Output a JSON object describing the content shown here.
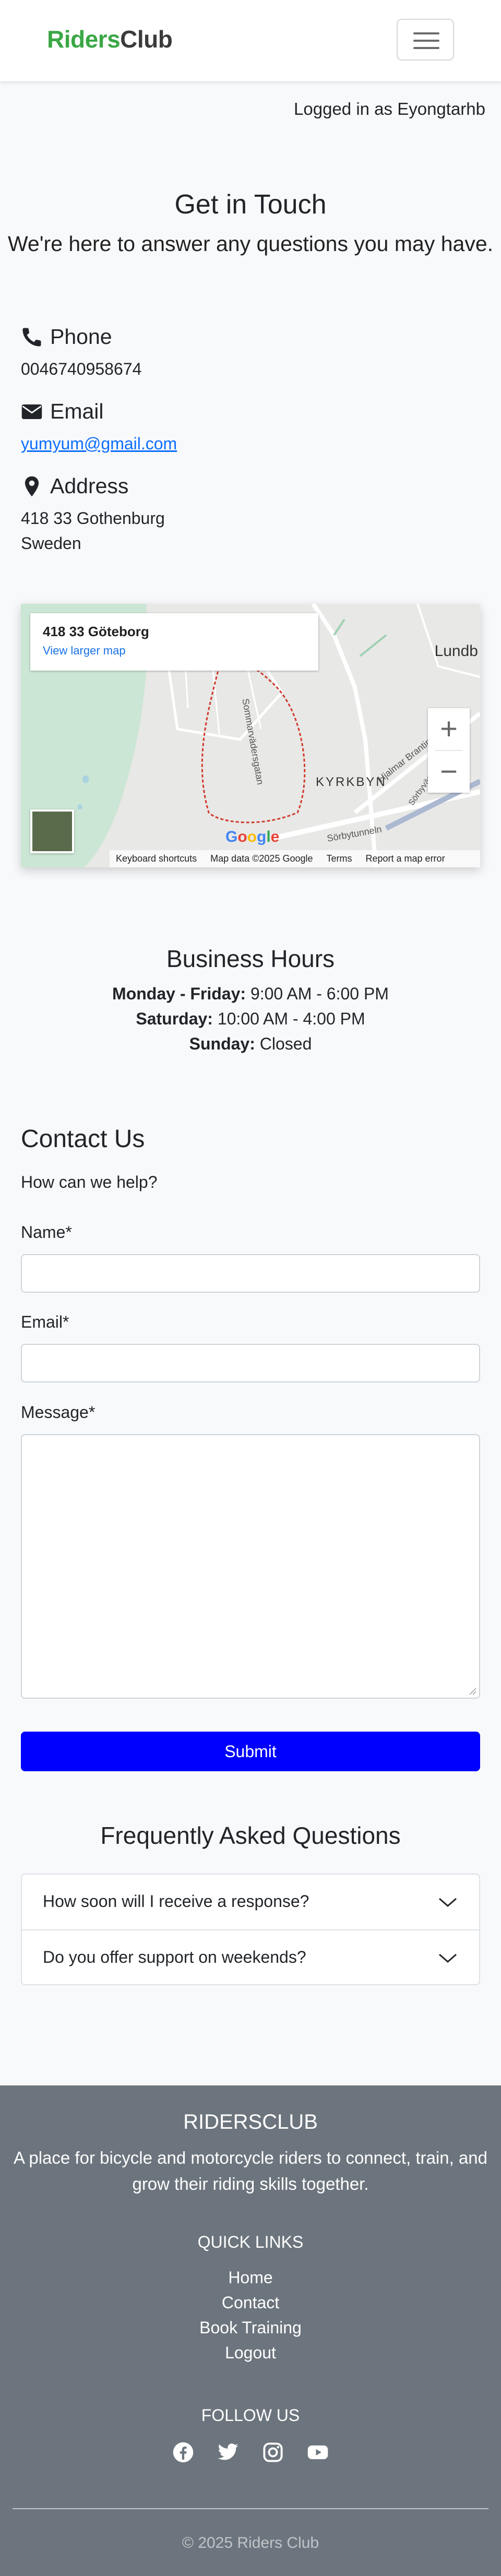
{
  "navbar": {
    "brand_part1": "Riders",
    "brand_part2": "Club"
  },
  "user_status": "Logged in as Eyongtarhb",
  "touch": {
    "title": "Get in Touch",
    "subtitle": "We're here to answer any questions you may have."
  },
  "contact_info": {
    "phone_label": "Phone",
    "phone_value": "0046740958674",
    "email_label": "Email",
    "email_value": "yumyum@gmail.com",
    "address_label": "Address",
    "address_line1": "418 33 Gothenburg",
    "address_line2": "Sweden"
  },
  "map": {
    "place": "418 33 Göteborg",
    "larger_map": "View larger map",
    "city_label": "Lundb",
    "area_label": "KYRKBYN",
    "street1": "Sommarvädersgatan",
    "street2": "Hjalmar Brantingsgatan",
    "street3": "Sörbytunneln",
    "street4": "Sörbyvägen",
    "footer_shortcuts": "Keyboard shortcuts",
    "footer_data": "Map data ©2025 Google",
    "footer_terms": "Terms",
    "footer_report": "Report a map error",
    "google": [
      "G",
      "o",
      "o",
      "g",
      "l",
      "e"
    ]
  },
  "business_hours": {
    "title": "Business Hours",
    "rows": [
      {
        "day": "Monday - Friday:",
        "hours": "9:00 AM - 6:00 PM"
      },
      {
        "day": "Saturday:",
        "hours": "10:00 AM - 4:00 PM"
      },
      {
        "day": "Sunday:",
        "hours": "Closed"
      }
    ]
  },
  "contact_form": {
    "title": "Contact Us",
    "subtitle": "How can we help?",
    "name_label": "Name*",
    "email_label": "Email*",
    "message_label": "Message*",
    "submit_label": "Submit"
  },
  "faq": {
    "title": "Frequently Asked Questions",
    "items": [
      "How soon will I receive a response?",
      "Do you offer support on weekends?"
    ]
  },
  "footer": {
    "brand": "RIDERSCLUB",
    "description": "A place for bicycle and motorcycle riders to connect, train, and grow their riding skills together.",
    "quick_links_title": "QUICK LINKS",
    "links": [
      "Home",
      "Contact",
      "Book Training",
      "Logout"
    ],
    "follow_title": "FOLLOW US",
    "socials": [
      "facebook-icon",
      "twitter-icon",
      "instagram-icon",
      "youtube-icon"
    ],
    "copyright": "© 2025 Riders Club"
  },
  "colors": {
    "brand_green": "#3aa745",
    "link_blue": "#0d6efd",
    "submit_blue": "#0000ff",
    "footer_gray": "#6c757d"
  }
}
